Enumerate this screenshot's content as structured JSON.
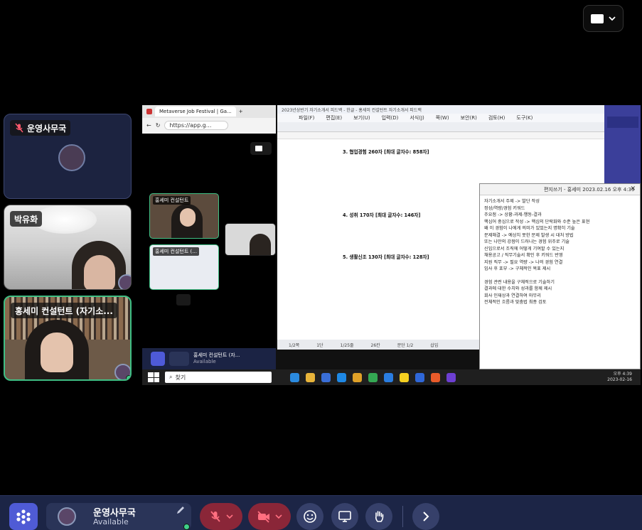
{
  "tiles": [
    {
      "name": "운영사무국",
      "muted": true
    },
    {
      "name": "박유화"
    },
    {
      "name": "홍세미 컨설턴트 (자기소..."
    }
  ],
  "shared_screen": {
    "browser": {
      "tab_label": "Metaverse Job Festival | Ga...",
      "url": "https://app.g..."
    },
    "mini_tiles": [
      {
        "name": "홍세미 컨설턴트"
      },
      {
        "name": "홍세미 컨설턴트 (..."
      }
    ],
    "mini_bar": {
      "name": "홍세미 컨설턴트 (자...",
      "status": "Available"
    },
    "doc": {
      "title": "2023년상반기 자기소개서 피드백 - 한글 - 홍세미 컨설턴트 자기소개서 피드백",
      "menus": [
        "파일(F)",
        "편집(E)",
        "보기(U)",
        "입력(D)",
        "서식(J)",
        "쪽(W)",
        "보안(R)",
        "검토(H)",
        "도구(K)"
      ],
      "paragraphs": [
        "3. 협업경험 260자 [최대 글자수: 858자]",
        "4. 성취 170자 [최대 글자수: 146자]",
        "5. 생활신조 130자 [최대 글자수: 128자]"
      ],
      "status": [
        "1/2쪽",
        "1단",
        "1/25줄",
        "26칸",
        "문단 1/2",
        "삽입"
      ]
    },
    "memo": {
      "title": "편지쓰기 - 홍세미 2023.02.16 오후 4:39",
      "lines": [
        "자기소개서 주제 -> 발단 작성",
        "정성/역량/경험 키워드",
        "주요점 -> 상황-과제-행동-결과",
        "핵심어 중심으로 작성 -> 핵심의 단락화와 수준 높은 표현",
        "왜 이 경험이 나에게 의미가 있었는지 명확히 기술",
        "문제해결 -> 예상치 못한 문제 발생 시 대처 방법",
        "또는 나만의 강점이 드러나는 경험 위주로 기술",
        "신입으로서 조직에 어떻게 기여할 수 있는지",
        "채용공고 / 직무기술서 확인 후 키워드 반영",
        "지원 직무 -> 필요 역량 -> 나의 경험 연결",
        "입사 후 포부 -> 구체적인 목표 제시",
        "",
        "경험 관련 내용을 구체적으로 기술하기",
        "결과에 대한 수치와 성과를 함께 제시",
        "회사 인재상과 연결하여 마무리",
        "전체적인 흐름과 맞춤법 최종 검토"
      ]
    },
    "taskbar": {
      "search_label": "찾기",
      "time": "오후 4:39",
      "date": "2023-02-16"
    }
  },
  "bottom_bar": {
    "user_name": "운영사무국",
    "user_status": "Available"
  },
  "colors": {
    "accent": "#4f5bd5",
    "bar_bg": "#1c2546",
    "danger": "#8a2638",
    "online": "#3fd08a"
  }
}
